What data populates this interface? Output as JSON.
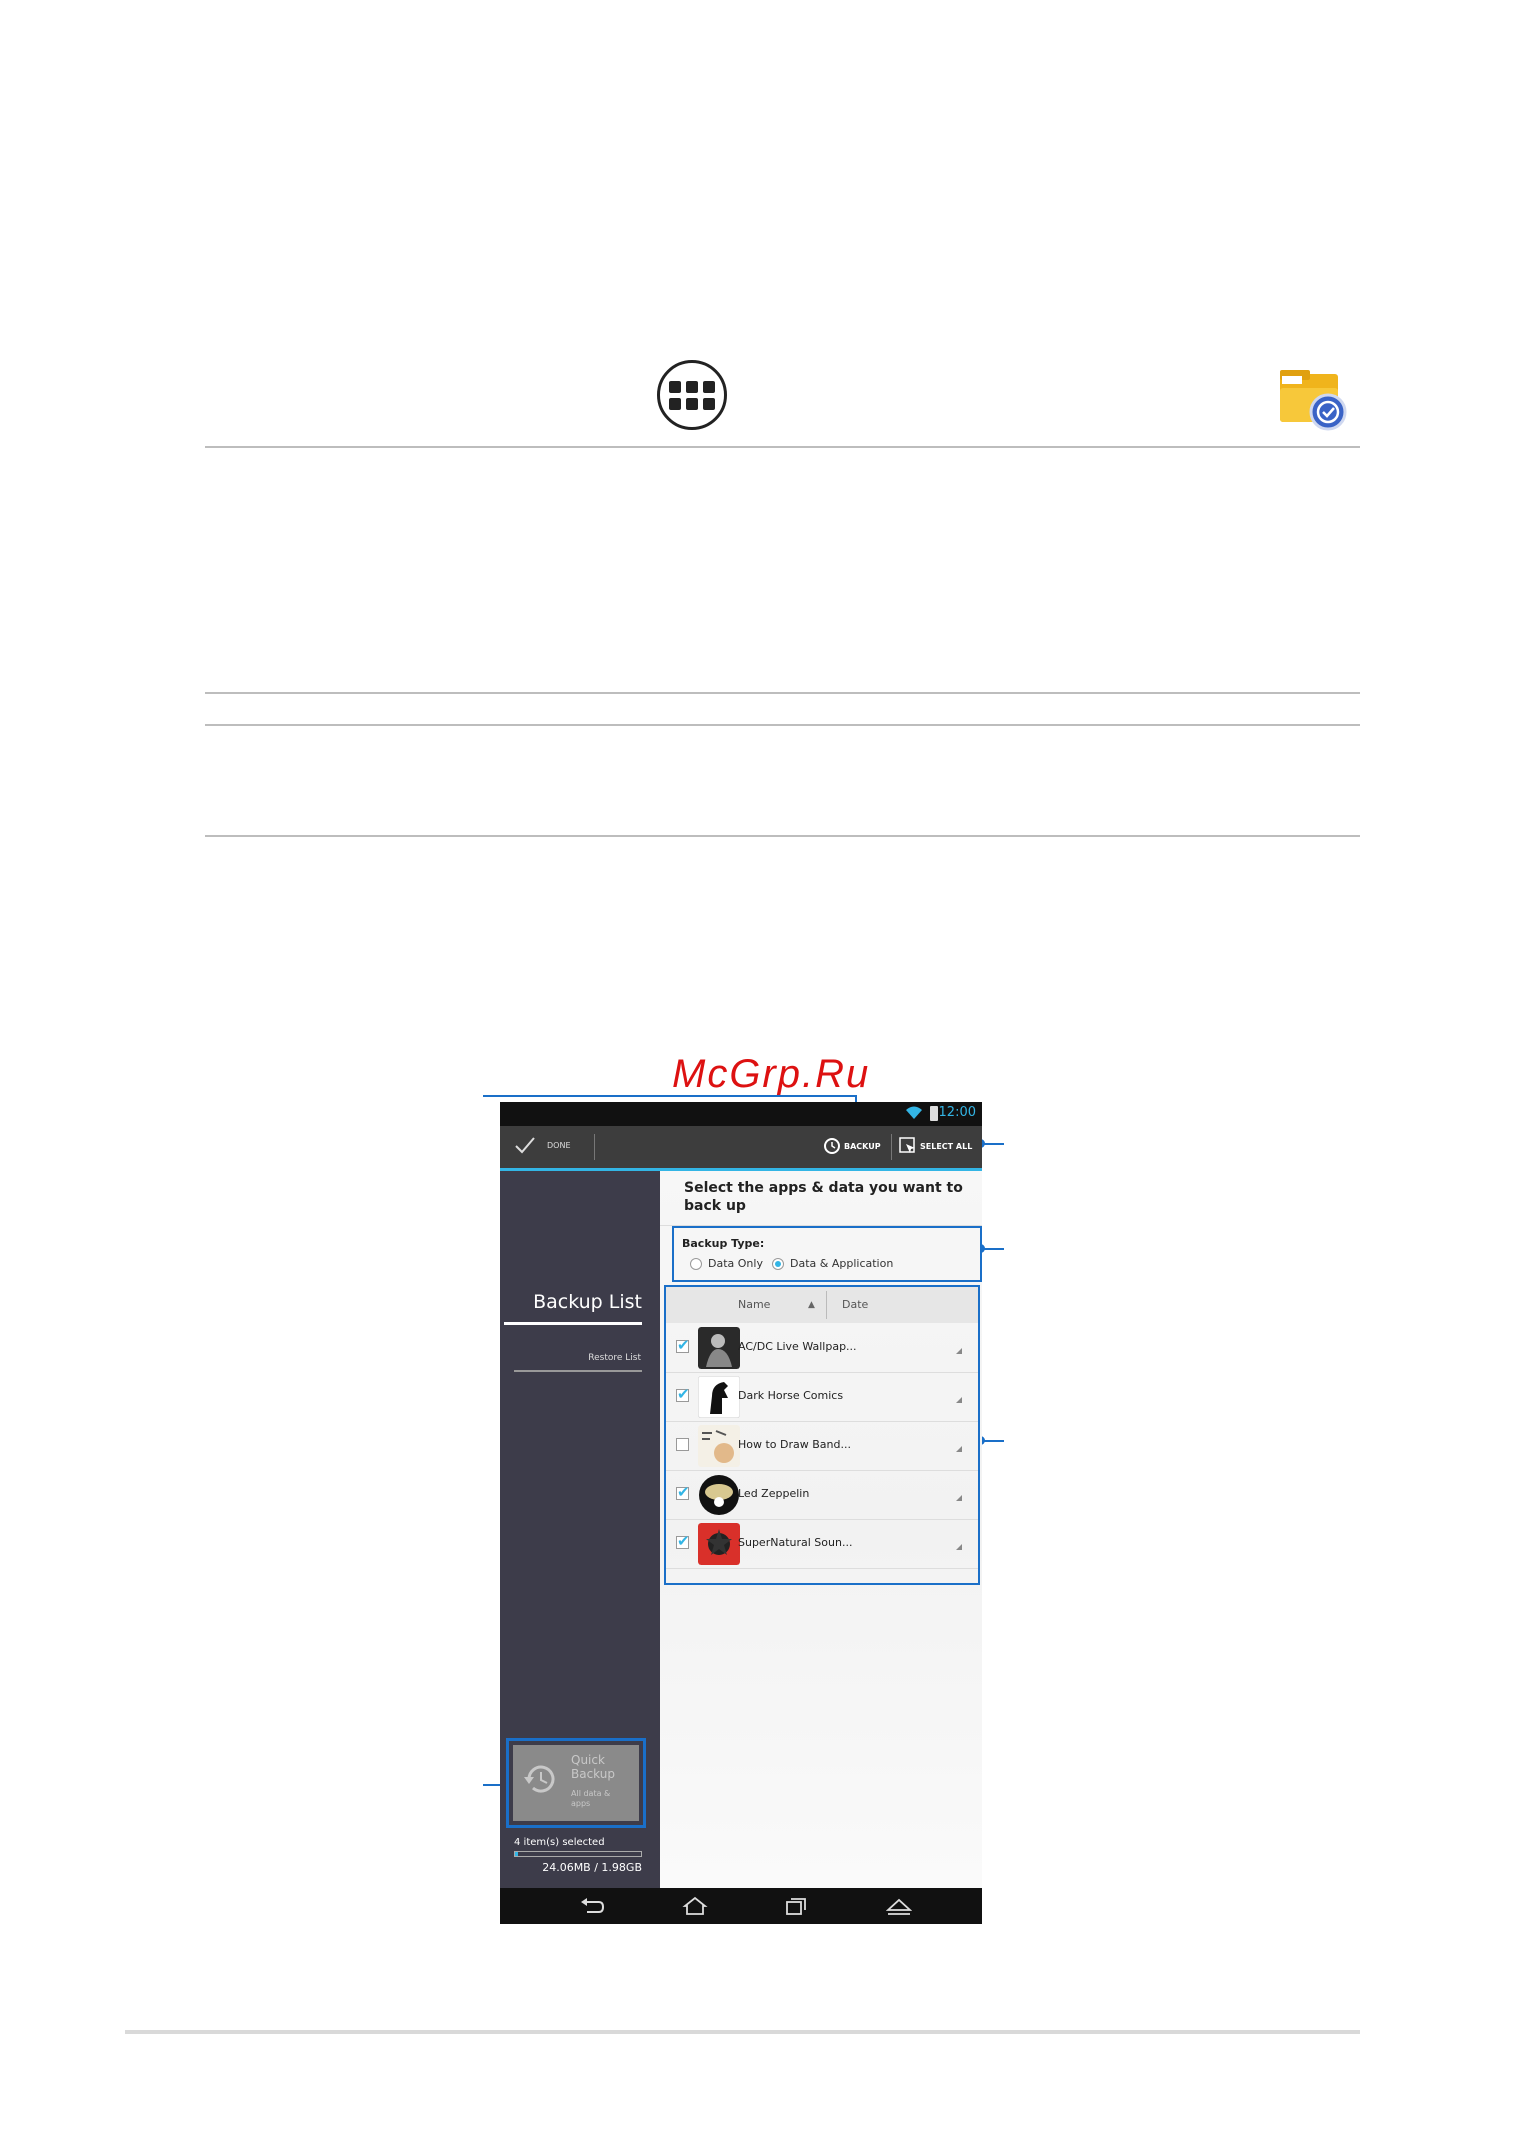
{
  "watermark": "McGrp.Ru",
  "phone": {
    "status": {
      "time": "12:00"
    },
    "action_bar": {
      "done_label": "DONE",
      "backup_label": "BACKUP",
      "select_all_label": "SELECT ALL"
    },
    "sidebar": {
      "title": "Backup List",
      "restore_label": "Restore List",
      "quick_backup": {
        "title": "Quick Backup",
        "subtitle": "All data & apps"
      },
      "selected_text": "4 item(s) selected",
      "storage_text": "24.06MB / 1.98GB"
    },
    "content": {
      "title": "Select the apps & data you want to back up",
      "backup_type": {
        "label": "Backup Type:",
        "options": [
          "Data Only",
          "Data & Application"
        ],
        "selected": "Data & Application"
      },
      "list_header": {
        "name": "Name",
        "date": "Date"
      },
      "apps": [
        {
          "name": "AC/DC Live Wallpap...",
          "checked": true
        },
        {
          "name": "Dark Horse Comics",
          "checked": true
        },
        {
          "name": "How to Draw Band...",
          "checked": false
        },
        {
          "name": "Led Zeppelin",
          "checked": true
        },
        {
          "name": "SuperNatural Soun...",
          "checked": true
        }
      ]
    }
  },
  "colors": {
    "accent": "#33b5e5",
    "callout": "#1a6fc8",
    "sidebar": "#3d3c4a",
    "actionbar": "#3d3d3d"
  },
  "icons": [
    "all-apps-icon",
    "backup-app-icon",
    "wifi-icon",
    "battery-icon",
    "check-icon",
    "backup-icon",
    "select-all-icon",
    "quick-backup-icon",
    "back-icon",
    "home-icon",
    "recent-apps-icon",
    "menu-icon"
  ]
}
